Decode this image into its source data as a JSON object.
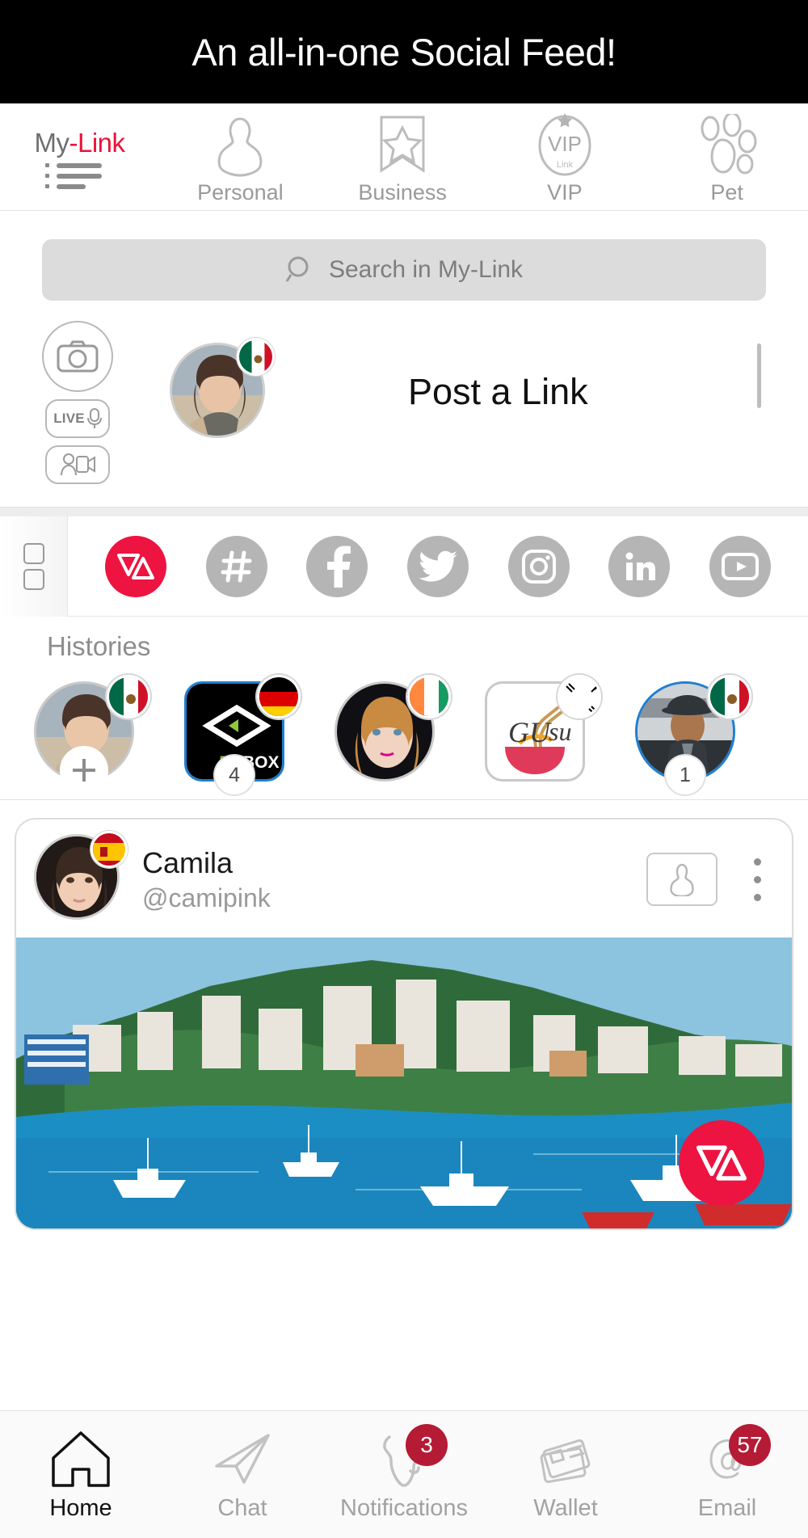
{
  "tagline": "An all-in-one Social Feed!",
  "brand": {
    "name_part1": "My",
    "name_part2": "-Link",
    "accent_color": "#e8143c",
    "menu_icon": "hamburger-menu-icon"
  },
  "topnav": {
    "items": [
      {
        "label": "Personal",
        "icon": "person-outline-icon"
      },
      {
        "label": "Business",
        "icon": "bookmark-star-icon"
      },
      {
        "label": "VIP",
        "icon": "vip-oval-icon",
        "sub": "Link"
      },
      {
        "label": "Pet",
        "icon": "paw-print-icon"
      }
    ]
  },
  "search": {
    "placeholder": "Search in My-Link",
    "icon": "search-icon"
  },
  "composer": {
    "prompt": "Post a Link",
    "actions": [
      {
        "name": "camera-button",
        "icon": "camera-icon"
      },
      {
        "name": "live-button",
        "icon": "live-mic-icon",
        "label": "LIVE"
      },
      {
        "name": "video-call-button",
        "icon": "video-person-icon"
      }
    ],
    "avatar_flag": "mexico-flag"
  },
  "social_strip": {
    "grid_toggle": "grid-view-toggle",
    "icons": [
      {
        "name": "mylink-icon",
        "label": "My-Link",
        "color": "#ed1441",
        "active": true
      },
      {
        "name": "hashtag-icon",
        "label": "Hashtag",
        "color": "#b5b5b5",
        "active": false
      },
      {
        "name": "facebook-icon",
        "label": "Facebook",
        "color": "#b5b5b5",
        "active": false
      },
      {
        "name": "twitter-icon",
        "label": "Twitter",
        "color": "#b5b5b5",
        "active": false
      },
      {
        "name": "instagram-icon",
        "label": "Instagram",
        "color": "#b5b5b5",
        "active": false
      },
      {
        "name": "linkedin-icon",
        "label": "LinkedIn",
        "color": "#b5b5b5",
        "active": false
      },
      {
        "name": "youtube-icon",
        "label": "YouTube",
        "color": "#b5b5b5",
        "active": false
      }
    ]
  },
  "histories": {
    "title": "Histories",
    "items": [
      {
        "name": "story-own",
        "shape": "round",
        "flag": "mexico-flag",
        "ring": "gray",
        "badge": "",
        "add": true,
        "logo_text": ""
      },
      {
        "name": "story-fitbox",
        "shape": "rounded",
        "flag": "germany-flag",
        "ring": "blue",
        "badge": "4",
        "add": false,
        "logo_text": "FITBOX"
      },
      {
        "name": "story-user-3",
        "shape": "round",
        "flag": "ireland-flag",
        "ring": "gray",
        "badge": "",
        "add": false,
        "logo_text": ""
      },
      {
        "name": "story-gusu",
        "shape": "rounded",
        "flag": "south-korea-flag",
        "ring": "gray",
        "badge": "",
        "add": false,
        "logo_text": "GUSU"
      },
      {
        "name": "story-user-5",
        "shape": "round",
        "flag": "mexico-flag",
        "ring": "blue",
        "badge": "1",
        "add": false,
        "logo_text": ""
      }
    ]
  },
  "post": {
    "author_name": "Camila",
    "author_handle": "@camipink",
    "author_flag": "spain-flag",
    "profile_button_icon": "person-outline-icon",
    "more_button_icon": "three-dots-vertical-icon",
    "fab_icon": "mylink-icon",
    "media_alt": "Acapulco bay with boats and hillside hotels"
  },
  "bottomnav": {
    "items": [
      {
        "label": "Home",
        "icon": "home-icon",
        "badge": "",
        "active": true
      },
      {
        "label": "Chat",
        "icon": "paper-plane-icon",
        "badge": "",
        "active": false
      },
      {
        "label": "Notifications",
        "icon": "bell-icon",
        "badge": "3",
        "active": false
      },
      {
        "label": "Wallet",
        "icon": "wallet-cards-icon",
        "badge": "",
        "active": false
      },
      {
        "label": "Email",
        "icon": "at-sign-icon",
        "badge": "57",
        "active": false
      }
    ],
    "badge_color": "#b51b35"
  }
}
